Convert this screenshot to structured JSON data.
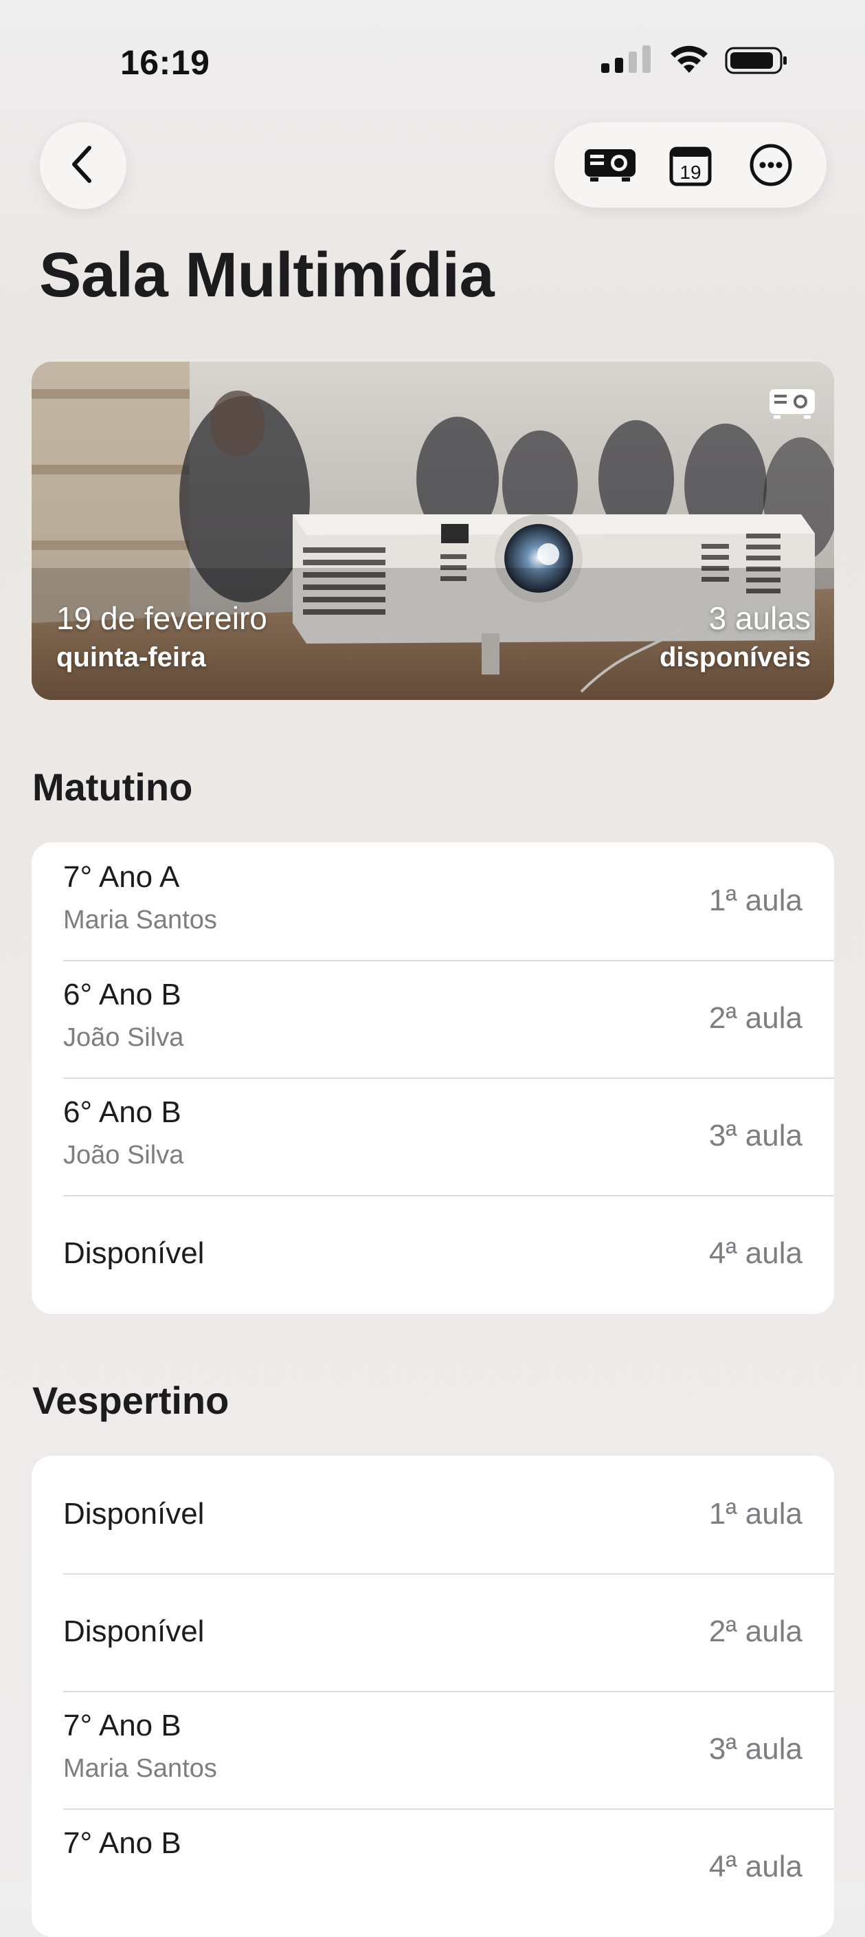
{
  "status_bar": {
    "time": "16:19"
  },
  "nav": {
    "back_icon": "chevron-left-icon",
    "actions": [
      "projector-icon",
      "calendar-icon",
      "more-icon"
    ],
    "calendar_day": "19"
  },
  "page": {
    "title": "Sala Multimídia"
  },
  "hero": {
    "date": "19 de fevereiro",
    "weekday": "quinta-feira",
    "count": "3 aulas",
    "count_label": "disponíveis"
  },
  "sections": [
    {
      "title": "Matutino",
      "rows": [
        {
          "main": "7° Ano A",
          "sub": "Maria Santos",
          "slot": "1ª aula"
        },
        {
          "main": "6° Ano B",
          "sub": "João Silva",
          "slot": "2ª aula"
        },
        {
          "main": "6° Ano B",
          "sub": "João Silva",
          "slot": "3ª aula"
        },
        {
          "main": "Disponível",
          "sub": "",
          "slot": "4ª aula"
        }
      ]
    },
    {
      "title": "Vespertino",
      "rows": [
        {
          "main": "Disponível",
          "sub": "",
          "slot": "1ª aula"
        },
        {
          "main": "Disponível",
          "sub": "",
          "slot": "2ª aula"
        },
        {
          "main": "7° Ano B",
          "sub": "Maria Santos",
          "slot": "3ª aula"
        },
        {
          "main": "7° Ano B",
          "sub": "",
          "slot": "4ª aula"
        }
      ]
    }
  ]
}
